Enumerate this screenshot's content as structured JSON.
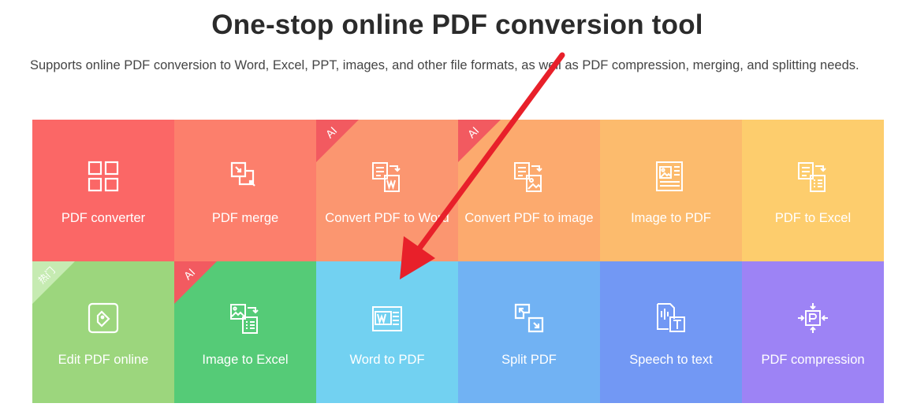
{
  "header": {
    "title": "One-stop online PDF conversion tool",
    "subtitle": "Supports online PDF conversion to Word, Excel, PPT, images, and other file formats, as well as PDF compression, merging, and splitting needs."
  },
  "tools": [
    {
      "label": "PDF converter",
      "color": "#fb6766",
      "icon": "grid-icon",
      "badge": ""
    },
    {
      "label": "PDF merge",
      "color": "#fc7f6c",
      "icon": "merge-icon",
      "badge": ""
    },
    {
      "label": "Convert PDF to Word",
      "color": "#fb9670",
      "icon": "pdf-to-word-icon",
      "badge": "AI"
    },
    {
      "label": "Convert PDF to image",
      "color": "#fcaa6e",
      "icon": "pdf-to-image-icon",
      "badge": "AI"
    },
    {
      "label": "Image to PDF",
      "color": "#fcbb6d",
      "icon": "image-to-pdf-icon",
      "badge": ""
    },
    {
      "label": "PDF to Excel",
      "color": "#fdcd6d",
      "icon": "pdf-to-excel-icon",
      "badge": ""
    },
    {
      "label": "Edit PDF online",
      "color": "#9cd67d",
      "icon": "edit-icon",
      "badge": "热门"
    },
    {
      "label": "Image to Excel",
      "color": "#55cb77",
      "icon": "image-to-excel-icon",
      "badge": "AI"
    },
    {
      "label": "Word to PDF",
      "color": "#72d1f1",
      "icon": "word-to-pdf-icon",
      "badge": ""
    },
    {
      "label": "Split PDF",
      "color": "#71b2f3",
      "icon": "split-icon",
      "badge": ""
    },
    {
      "label": "Speech to text",
      "color": "#7298f4",
      "icon": "speech-to-text-icon",
      "badge": ""
    },
    {
      "label": "PDF compression",
      "color": "#9d83f5",
      "icon": "compress-icon",
      "badge": ""
    }
  ],
  "colors": {
    "ai_ribbon": "#f25a60",
    "hot_ribbon": "#c6ebb2",
    "annotation_arrow": "#e8202a"
  }
}
